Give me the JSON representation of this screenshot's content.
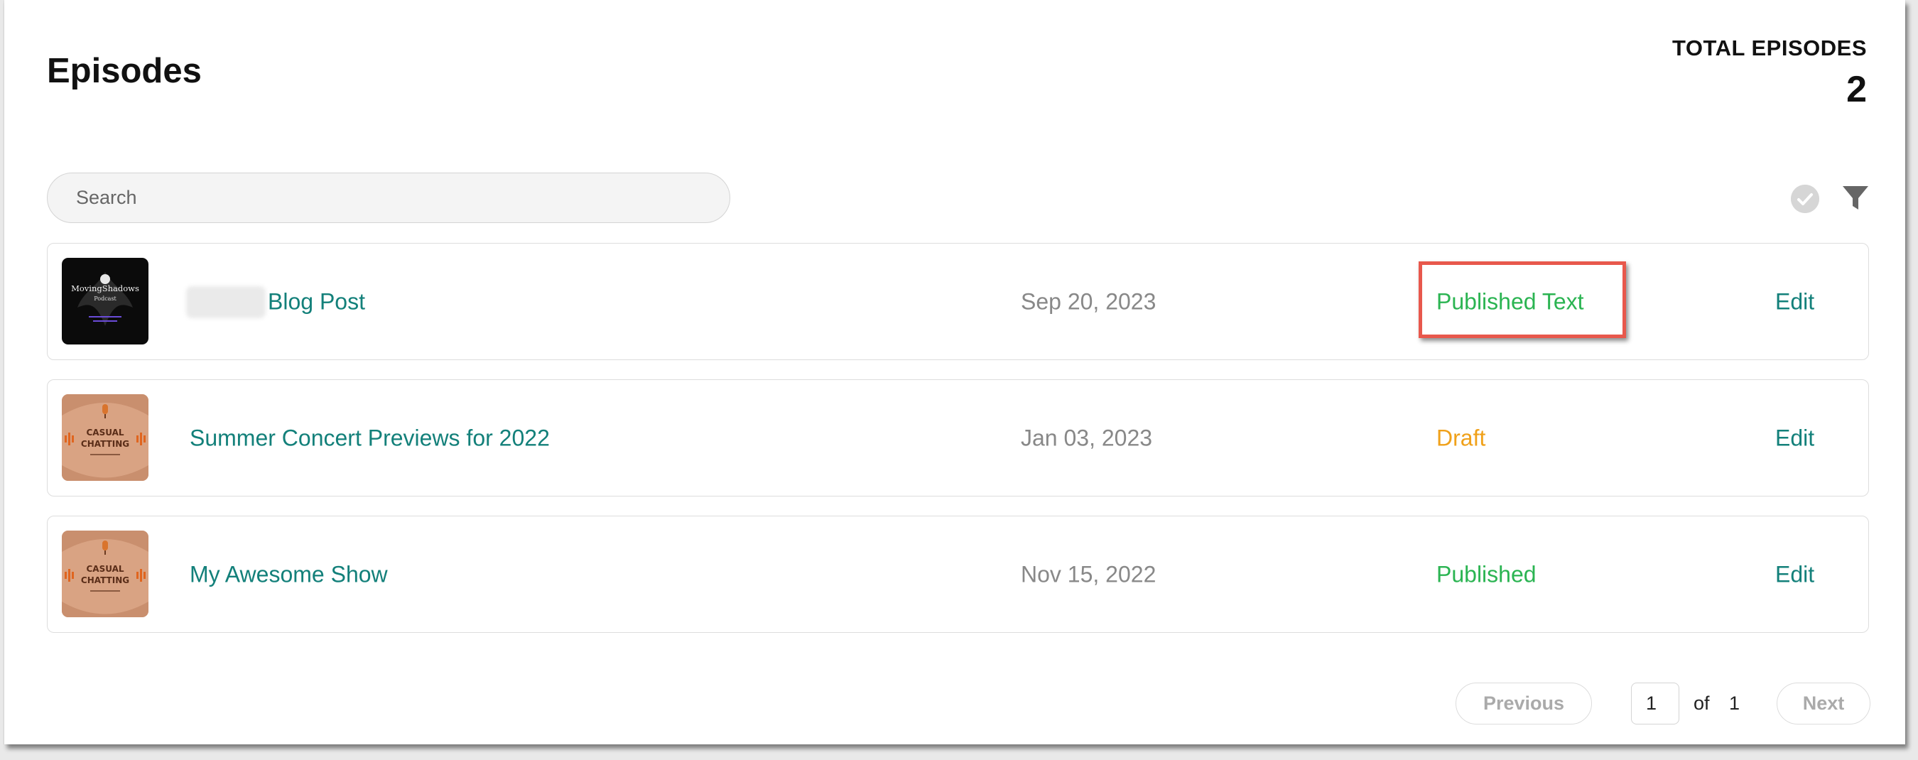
{
  "header": {
    "title": "Episodes",
    "total_label": "TOTAL EPISODES",
    "total_count": "2"
  },
  "search": {
    "placeholder": "Search"
  },
  "toolbar": {
    "check_icon": "check-circle-icon",
    "filter_icon": "filter-icon"
  },
  "episodes": [
    {
      "thumbnail": "moving-shadows-podcast-art",
      "title": "Blog Post",
      "date": "Sep 20, 2023",
      "status": "Published Text",
      "status_color": "#2bb452",
      "edit_label": "Edit"
    },
    {
      "thumbnail": "casual-chatting-art",
      "title": "Summer Concert Previews for 2022",
      "date": "Jan 03, 2023",
      "status": "Draft",
      "status_color": "#f0a11a",
      "edit_label": "Edit"
    },
    {
      "thumbnail": "casual-chatting-art",
      "title": "My Awesome Show",
      "date": "Nov 15, 2022",
      "status": "Published",
      "status_color": "#2bb452",
      "edit_label": "Edit"
    }
  ],
  "thumbnail_text": {
    "moving_shadows": "MovingShadows",
    "moving_shadows_sub": "Podcast",
    "casual_line1": "CASUAL",
    "casual_line2": "CHATTING"
  },
  "pagination": {
    "previous_label": "Previous",
    "current_page": "1",
    "of_label": "of",
    "total_pages": "1",
    "next_label": "Next"
  },
  "colors": {
    "accent_teal": "#13807a",
    "published_green": "#2bb452",
    "draft_orange": "#f0a11a",
    "highlight_red": "#e8584c"
  }
}
